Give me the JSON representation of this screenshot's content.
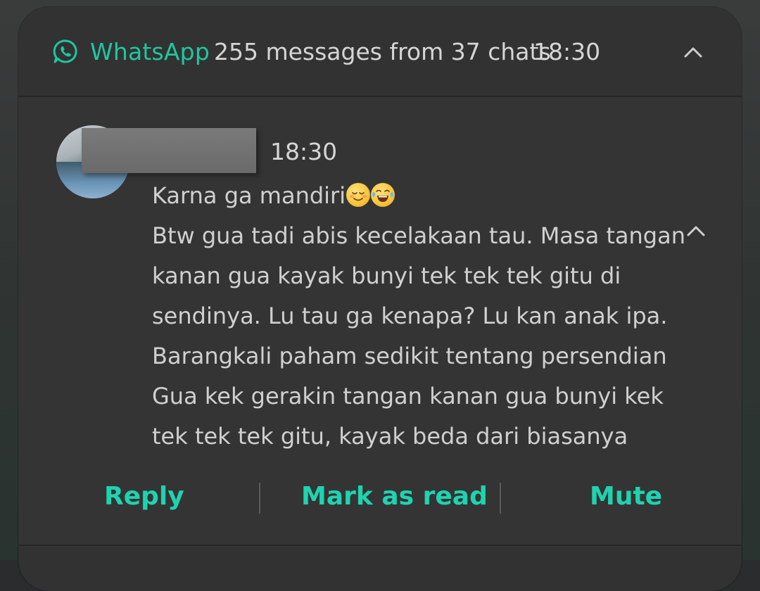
{
  "notification": {
    "app_name": "WhatsApp",
    "summary": "255 messages from 37 chats",
    "time": "18:30",
    "app_icon": "whatsapp-icon",
    "collapse_icon": "chevron-up-icon",
    "accent_color": "#1fc7a0"
  },
  "message": {
    "sender_redacted": true,
    "time": "18:30",
    "lines": [
      "Karna ga mandiri",
      "Btw gua tadi abis kecelakaan tau. Masa tangan",
      "kanan gua kayak bunyi tek tek tek gitu di",
      "sendinya. Lu tau ga kenapa? Lu kan anak ipa.",
      "Barangkali paham sedikit tentang persendian",
      "Gua kek gerakin tangan kanan gua bunyi kek",
      "tek tek tek gitu, kayak beda dari biasanya"
    ],
    "emojis": [
      "relieved-face-emoji",
      "tears-of-joy-emoji"
    ],
    "collapse_icon": "chevron-up-icon"
  },
  "actions": {
    "reply": "Reply",
    "mark_as_read": "Mark as read",
    "mute": "Mute",
    "color": "#1fd3b0"
  }
}
